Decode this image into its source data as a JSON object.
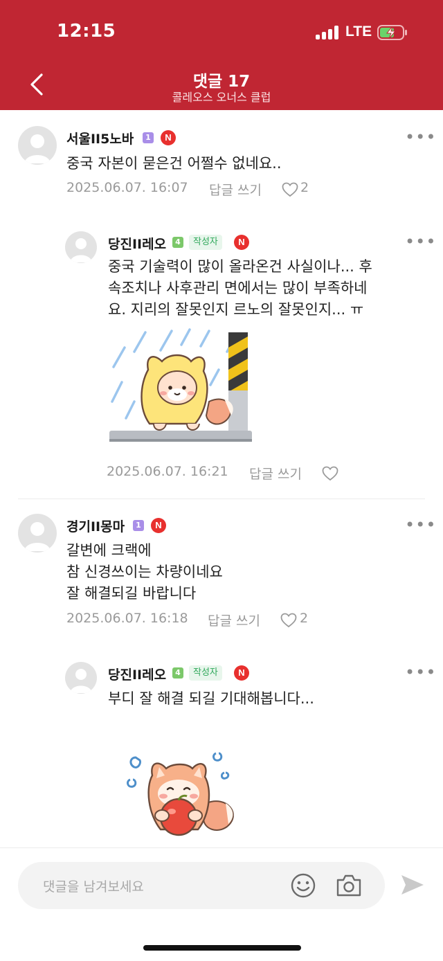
{
  "status": {
    "time": "12:15",
    "network": "LTE"
  },
  "header": {
    "title": "댓글 17",
    "subtitle": "콜레오스 오너스 클럽"
  },
  "comments": [
    {
      "author": "서울II5노바",
      "level": "1",
      "n_badge": "N",
      "text": "중국 자본이 묻은건 어쩔수 없네요..",
      "date": "2025.06.07. 16:07",
      "reply_label": "답글 쓰기",
      "likes": "2",
      "more": "•••"
    },
    {
      "author": "당진II레오",
      "level": "4",
      "author_badge": "작성자",
      "n_badge": "N",
      "text": "중국 기술력이 많이 올라온건 사실이나... 후\n속조치나 사후관리 면에서는 많이 부족하네\n요. 지리의 잘못인지 르노의 잘못인지... ㅠ",
      "date": "2025.06.07. 16:21",
      "reply_label": "답글 쓰기",
      "more": "•••"
    },
    {
      "author": "경기II몽마",
      "level": "1",
      "n_badge": "N",
      "text": "갈변에 크랙에\n참 신경쓰이는 차량이네요\n잘 해결되길 바랍니다",
      "date": "2025.06.07. 16:18",
      "reply_label": "답글 쓰기",
      "likes": "2",
      "more": "•••"
    },
    {
      "author": "당진II레오",
      "level": "4",
      "author_badge": "작성자",
      "n_badge": "N",
      "text": "부디 잘 해결 되길 기대해봅니다...",
      "more": "•••"
    }
  ],
  "input": {
    "placeholder": "댓글을 남겨보세요"
  },
  "colors": {
    "header_bg": "#c02633",
    "n_badge": "#e8302e",
    "author_badge_text": "#2fa85a"
  }
}
